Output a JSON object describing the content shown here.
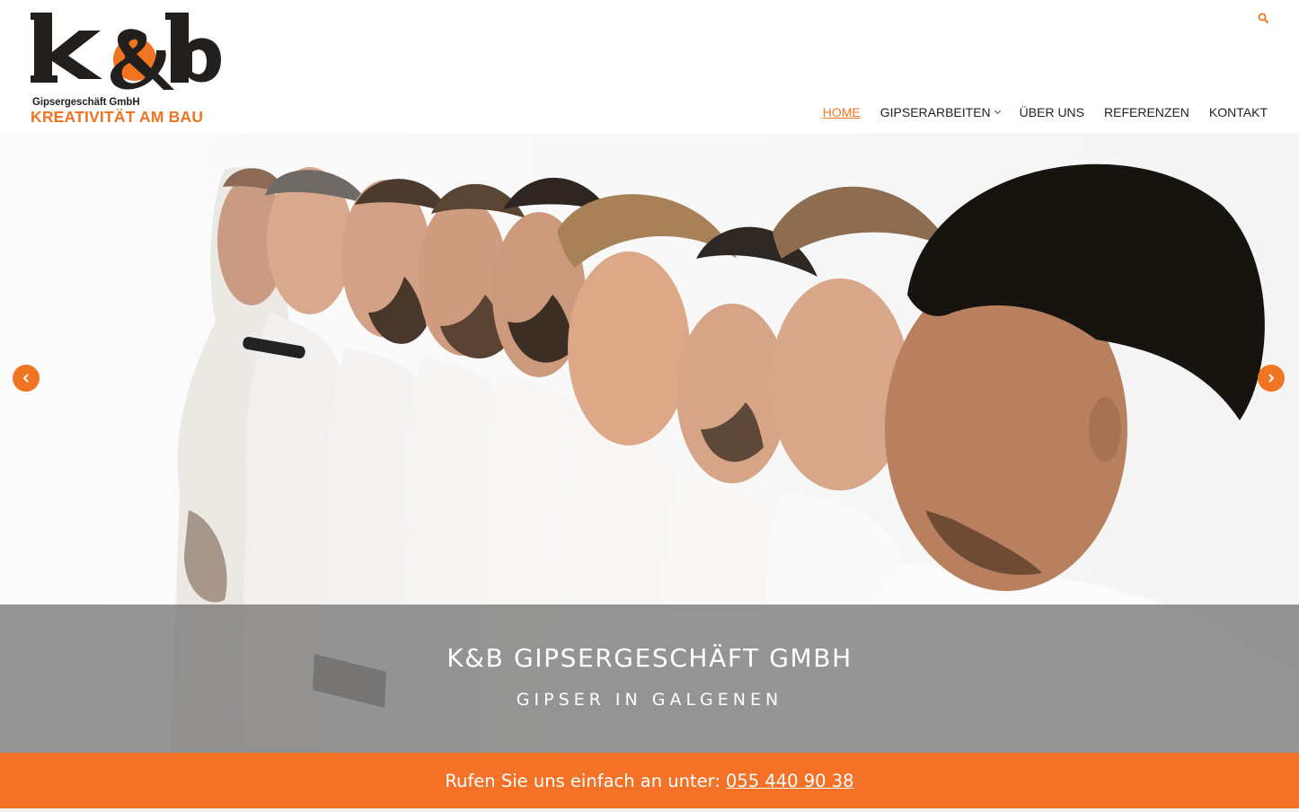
{
  "logo": {
    "mark": "k&b",
    "subtitle": "Gipsergeschäft GmbH",
    "tagline": "KREATIVITÄT AM BAU"
  },
  "header": {
    "search_icon": "search-icon"
  },
  "nav": {
    "items": [
      {
        "label": "HOME",
        "active": true
      },
      {
        "label": "GIPSERARBEITEN",
        "has_dropdown": true
      },
      {
        "label": "ÜBER UNS"
      },
      {
        "label": "REFERENZEN"
      },
      {
        "label": "KONTAKT"
      }
    ]
  },
  "hero": {
    "title": "K&B GIPSERGESCHÄFT GMBH",
    "subtitle": "GIPSER IN GALGENEN",
    "prev_icon": "chevron-left-icon",
    "next_icon": "chevron-right-icon"
  },
  "cta": {
    "text": "Rufen Sie uns einfach an unter:",
    "phone": "055 440 90 38"
  },
  "colors": {
    "accent": "#f07422",
    "cta_background": "#f47227",
    "text": "#222222"
  }
}
